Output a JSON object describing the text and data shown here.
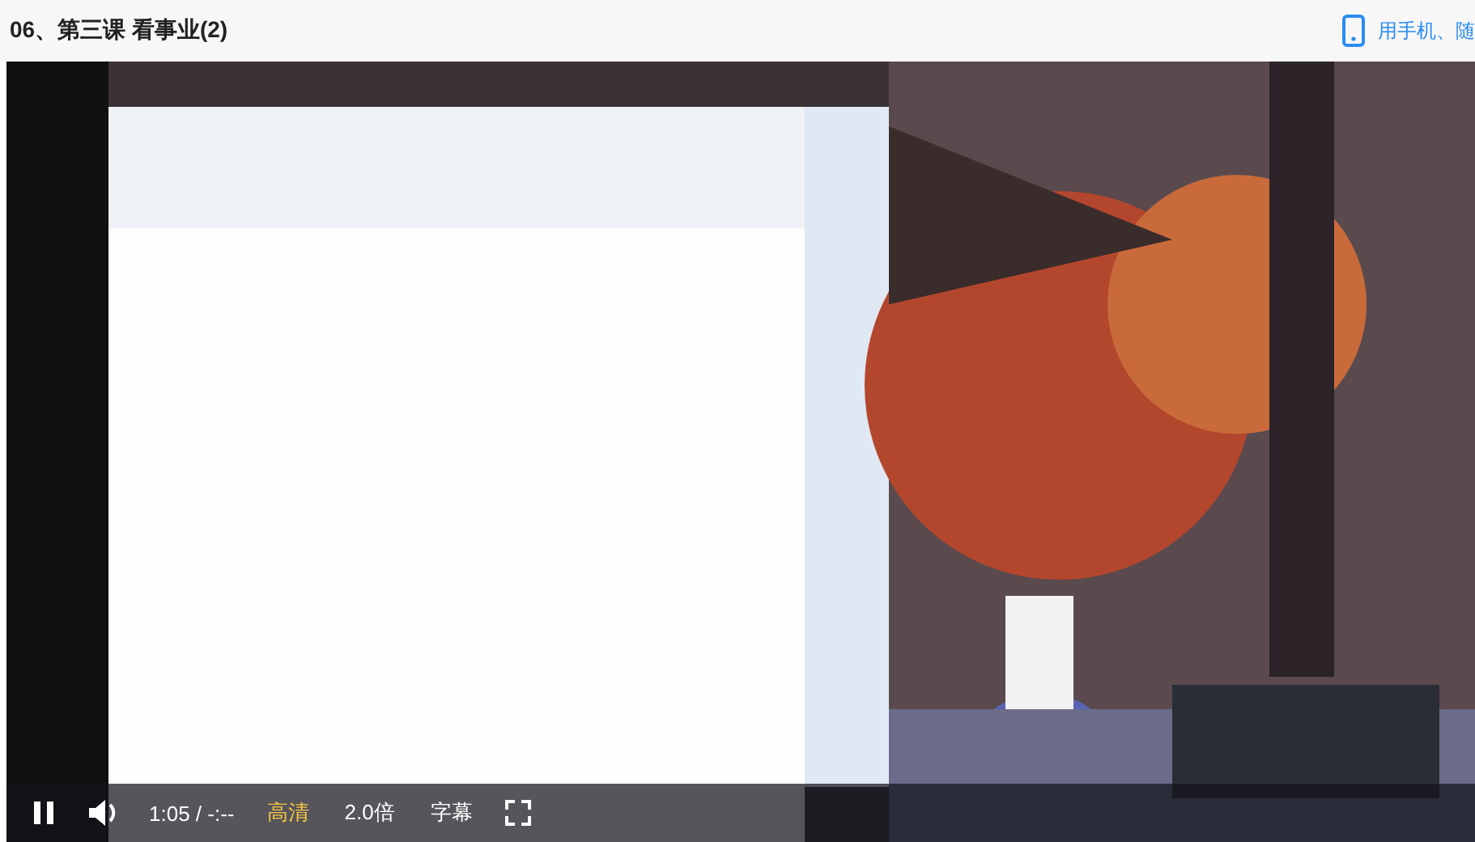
{
  "header": {
    "title": "06、第三课 看事业(2)",
    "mobile_link": "用手机、随"
  },
  "player": {
    "playing": true,
    "time": "1:05 / -:--",
    "quality": "高清",
    "speed": "2.0倍",
    "subtitles": "字幕"
  }
}
